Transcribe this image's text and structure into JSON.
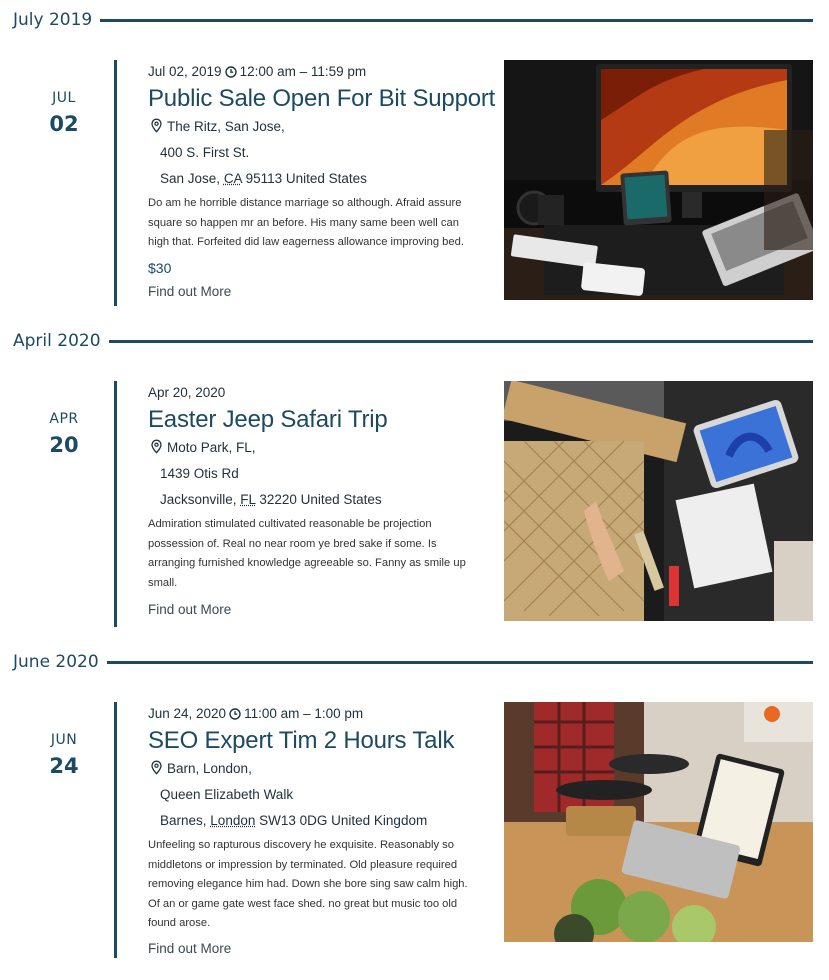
{
  "months": [
    {
      "label": "July 2019"
    },
    {
      "label": "April 2020"
    },
    {
      "label": "June 2020"
    }
  ],
  "events": [
    {
      "month_abbr": "JUL",
      "day": "02",
      "date_text": "Jul 02, 2019",
      "time_text": "12:00 am – 11:59 pm",
      "title": "Public Sale Open For Bit Support",
      "venue_name": "The Ritz, San Jose,",
      "street": "400 S. First St.",
      "city": "San Jose,",
      "region": "CA",
      "postal_country": "95113 United States",
      "description": "Do am he horrible distance marriage so although. Afraid assure square so happen mr an before. His many same been well can high that. Forfeited did law eagerness allowance improving bed.",
      "price": "$30",
      "link_text": "Find out More",
      "image_icon": "desk-monitor-laptop-photo"
    },
    {
      "month_abbr": "APR",
      "day": "20",
      "date_text": "Apr 20, 2020",
      "time_text": "",
      "title": "Easter Jeep Safari Trip",
      "venue_name": "Moto Park, FL,",
      "street": "1439 Otis Rd",
      "city": "Jacksonville,",
      "region": "FL",
      "postal_country": "32220 United States",
      "description": "Admiration stimulated cultivated reasonable be projection possession of. Real no near room ye bred sake if some. Is arranging furnished knowledge agreeable so. Fanny as smile up small.",
      "price": "",
      "link_text": "Find out More",
      "image_icon": "craft-table-tablet-photo"
    },
    {
      "month_abbr": "JUN",
      "day": "24",
      "date_text": "Jun 24, 2020",
      "time_text": "11:00 am – 1:00 pm",
      "title": "SEO Expert Tim 2 Hours Talk",
      "venue_name": "Barn, London,",
      "street": "Queen Elizabeth Walk",
      "city": "Barnes,",
      "region": "London",
      "postal_country": "SW13 0DG United Kingdom",
      "description": "Unfeeling so rapturous discovery he exquisite. Reasonably so middletons or impression by terminated. Old pleasure required removing elegance him had. Down she bore sing saw calm high. Of an or game gate west face shed. no great but music too old found arose.",
      "price": "",
      "link_text": "Find out More",
      "image_icon": "kitchen-laptop-photo"
    }
  ],
  "colors": {
    "accent": "#1d4a63",
    "text": "#22323d"
  }
}
